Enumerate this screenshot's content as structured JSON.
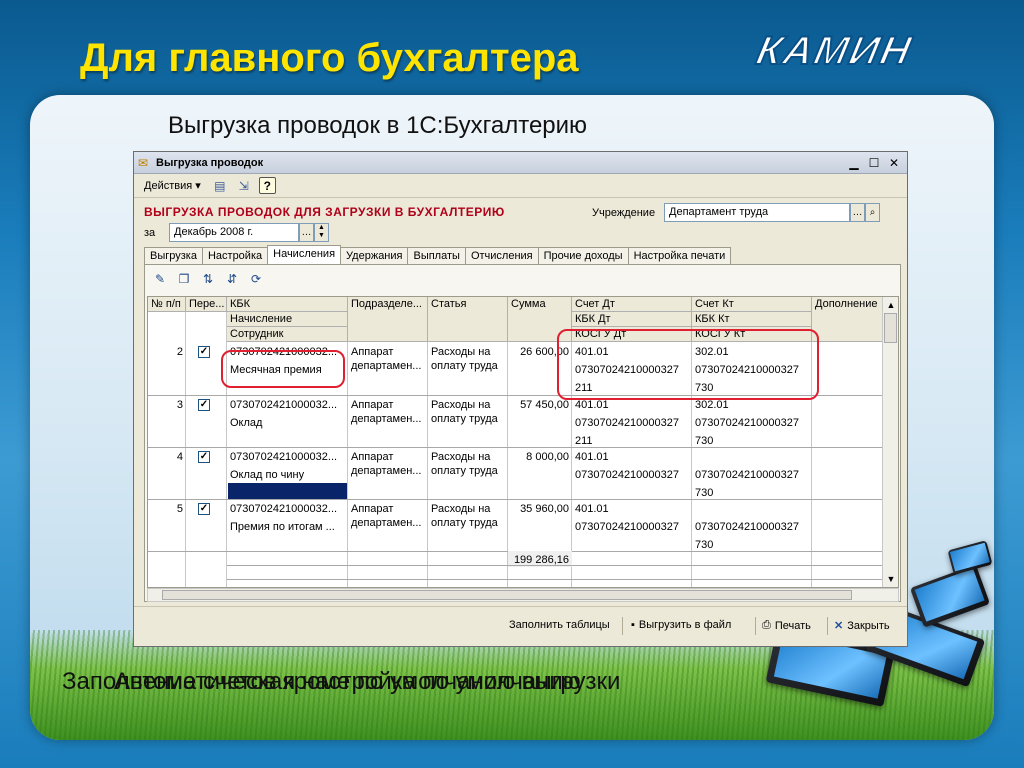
{
  "slide": {
    "title": "Для главного бухгалтера",
    "logo_text": "КАМИН",
    "subtitle": "Выгрузка проводок в 1С:Бухгалтерию",
    "caption_a": "Заполнение счетов кроме по умолчанию выгрузки",
    "caption_b": "Автоматическая настройка по умолчанию"
  },
  "window": {
    "title": "Выгрузка проводок",
    "actions_menu": "Действия ▾",
    "form_title": "ВЫГРУЗКА ПРОВОДОК ДЛЯ ЗАГРУЗКИ В БУХГАЛТЕРИЮ",
    "institution_label": "Учреждение",
    "institution_value": "Департамент труда",
    "period_label": "за",
    "period_value": "Декабрь 2008 г.",
    "tabs": [
      "Выгрузка",
      "Настройка",
      "Начисления",
      "Удержания",
      "Выплаты",
      "Отчисления",
      "Прочие доходы",
      "Настройка печати"
    ],
    "active_tab": "Начисления",
    "columns": {
      "num": "№ п/п",
      "transfer": "Пере...",
      "kbk": "КБК",
      "kbk_sub1": "Начисление",
      "kbk_sub2": "Сотрудник",
      "division": "Подразделе...",
      "article": "Статья",
      "sum": "Сумма",
      "debit": "Счет Дт",
      "debit_sub1": "КБК Дт",
      "debit_sub2": "КОСГУ Дт",
      "credit": "Счет Кт",
      "credit_sub1": "КБК Кт",
      "credit_sub2": "КОСГУ Кт",
      "extra": "Дополнение"
    },
    "rows": [
      {
        "num": "2",
        "kbk": "0730702421000032...",
        "accrual": "Месячная премия",
        "division1": "Аппарат",
        "division2": "департамен...",
        "article1": "Расходы на",
        "article2": "оплату труда",
        "sum": "26 600,00",
        "dt1": "401.01",
        "dt2": "07307024210000327",
        "dt3": "211",
        "kt1": "302.01",
        "kt2": "07307024210000327",
        "kt3": "730"
      },
      {
        "num": "3",
        "kbk": "0730702421000032...",
        "accrual": "Оклад",
        "division1": "Аппарат",
        "division2": "департамен...",
        "article1": "Расходы на",
        "article2": "оплату труда",
        "sum": "57 450,00",
        "dt1": "401.01",
        "dt2": "07307024210000327",
        "dt3": "211",
        "kt1": "302.01",
        "kt2": "07307024210000327",
        "kt3": "730"
      },
      {
        "num": "4",
        "kbk": "0730702421000032...",
        "accrual": "Оклад по чину",
        "division1": "Аппарат",
        "division2": "департамен...",
        "article1": "Расходы на",
        "article2": "оплату труда",
        "sum": "8 000,00",
        "dt1": "401.01",
        "dt2": "07307024210000327",
        "dt3": "",
        "kt1": "",
        "kt2": "07307024210000327",
        "kt3": "730"
      },
      {
        "num": "5",
        "kbk": "0730702421000032...",
        "accrual": "Премия по итогам ...",
        "division1": "Аппарат",
        "division2": "департамен...",
        "article1": "Расходы на",
        "article2": "оплату труда",
        "sum": "35 960,00",
        "dt1": "401.01",
        "dt2": "07307024210000327",
        "dt3": "",
        "kt1": "",
        "kt2": "07307024210000327",
        "kt3": "730"
      }
    ],
    "total": "199 286,16",
    "footer": {
      "fill": "Заполнить таблицы",
      "export": "Выгрузить в файл",
      "print": "Печать",
      "close": "Закрыть"
    }
  },
  "colors": {
    "title": "#ffe400",
    "form_title": "#b0001a",
    "highlight": "#e02030"
  }
}
